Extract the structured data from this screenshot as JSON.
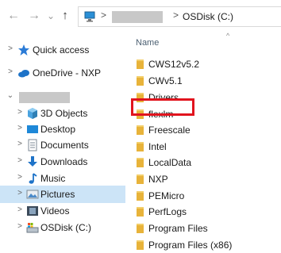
{
  "address": {
    "back": "←",
    "forward": "→",
    "recent": "⌄",
    "up": "↑",
    "separator": ">",
    "current": "OSDisk (C:)"
  },
  "nav": {
    "quick_access": "Quick access",
    "onedrive": "OneDrive - NXP",
    "items": [
      {
        "label": "3D Objects",
        "icon": "3d-objects-icon"
      },
      {
        "label": "Desktop",
        "icon": "desktop-icon"
      },
      {
        "label": "Documents",
        "icon": "documents-icon"
      },
      {
        "label": "Downloads",
        "icon": "downloads-icon"
      },
      {
        "label": "Music",
        "icon": "music-icon"
      },
      {
        "label": "Pictures",
        "icon": "pictures-icon"
      },
      {
        "label": "Videos",
        "icon": "videos-icon"
      },
      {
        "label": "OSDisk (C:)",
        "icon": "drive-icon"
      }
    ],
    "chev_closed": ">",
    "chev_open": "⌄"
  },
  "list": {
    "column_name": "Name",
    "sort_indicator": "^",
    "folders": [
      "CWS12v5.2",
      "CWv5.1",
      "Drivers",
      "flexlm",
      "Freescale",
      "Intel",
      "LocalData",
      "NXP",
      "PEMicro",
      "PerfLogs",
      "Program Files",
      "Program Files (x86)"
    ]
  },
  "colors": {
    "folder": "#e8b33a",
    "selection": "#cce4f7",
    "highlight": "#e1141e",
    "onedrive": "#1e73c8",
    "star": "#2b7bd6"
  }
}
